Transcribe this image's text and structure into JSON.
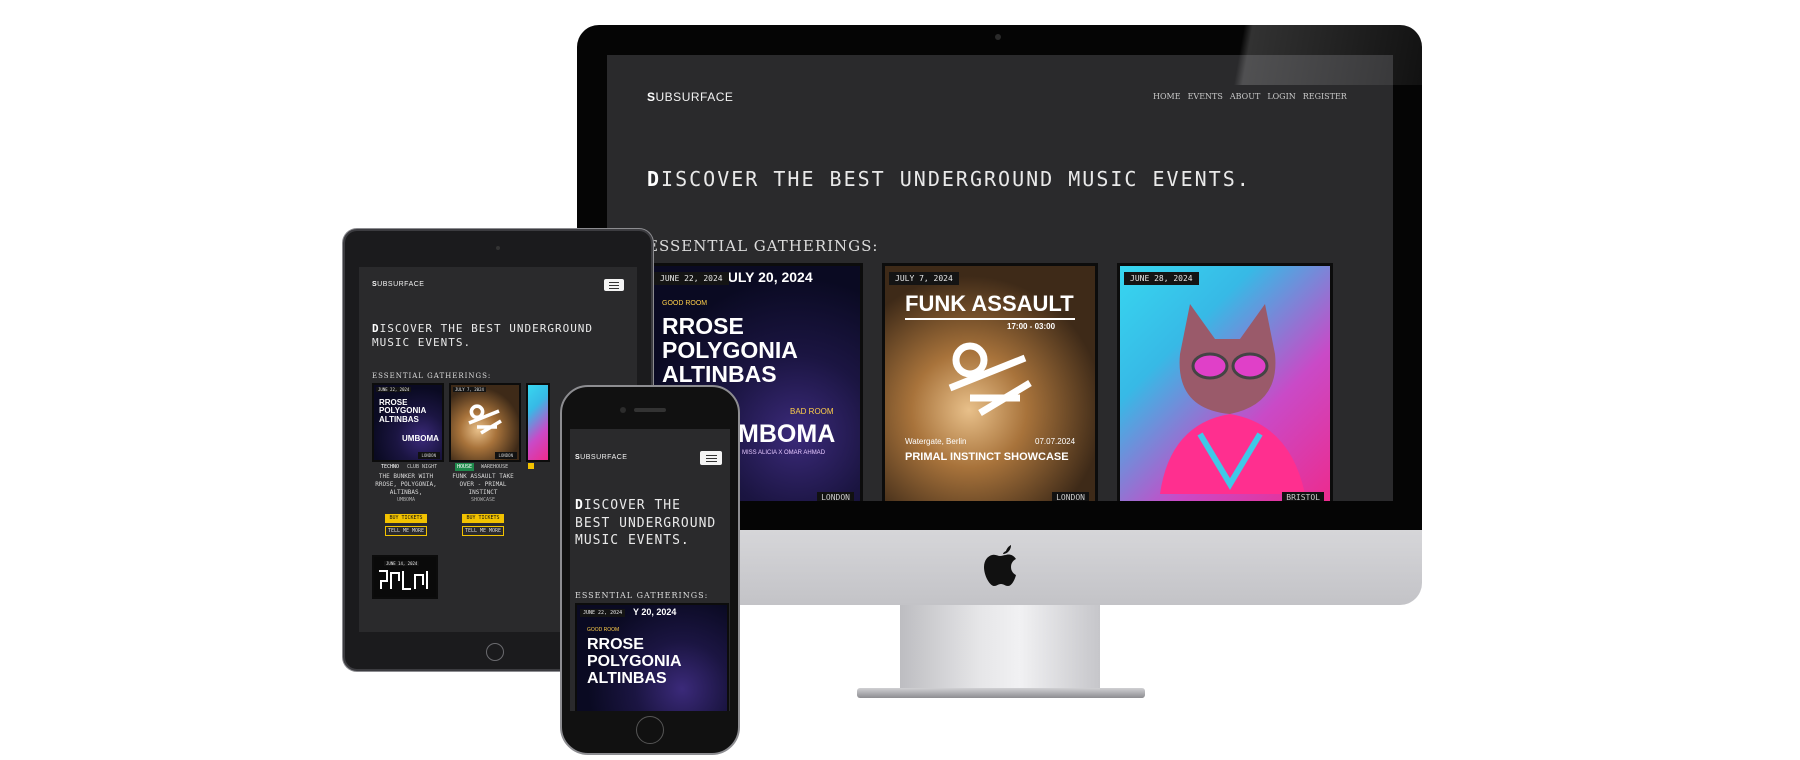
{
  "site": {
    "logo_first": "S",
    "logo_rest": "UBSURFACE",
    "logo_rest_short": "UBSURFACE",
    "nav": [
      "HOME",
      "EVENTS",
      "ABOUT",
      "LOGIN",
      "REGISTER"
    ],
    "hero_first": "D",
    "hero_rest": "ISCOVER THE BEST UNDERGROUND MUSIC EVENTS.",
    "section_title": "ESSENTIAL GATHERINGS:"
  },
  "desktop_cards": [
    {
      "date": "JUNE 22, 2024",
      "top": "JULY 20, 2024",
      "venue": "GOOD ROOM",
      "line1": "RROSE",
      "line2": "POLYGONIA",
      "line3": "ALTINBAS",
      "room": "BAD ROOM",
      "headliner": "UMBOMA",
      "support": "MISS ALICIA X OMAR AHMAD",
      "city": "LONDON"
    },
    {
      "date": "JULY 7, 2024",
      "title": "FUNK ASSAULT",
      "time": "17:00 - 03:00",
      "place": "Watergate, Berlin",
      "date2": "07.07.2024",
      "subtitle": "PRIMAL INSTINCT SHOWCASE",
      "city": "LONDON"
    },
    {
      "date": "JUNE 28, 2024",
      "city": "BRISTOL"
    }
  ],
  "tablet": {
    "cards": [
      {
        "date": "JUNE 22, 2024",
        "line1": "RROSE",
        "line2": "POLYGONIA",
        "line3": "ALTINBAS",
        "headliner": "UMBOMA",
        "city": "LONDON",
        "tag1": "TECHNO",
        "tag2": "CLUB NIGHT",
        "name": "THE BUNKER WITH RROSE, POLYGONIA, ALTINBAS,",
        "extra": "UMBOMA",
        "buy": "BUY TICKETS",
        "more": "TELL ME MORE"
      },
      {
        "date": "JULY 7, 2024",
        "city": "LONDON",
        "tag1": "HOUSE",
        "tag2": "WAREHOUSE",
        "name": "FUNK ASSAULT TAKE OVER - PRIMAL INSTINCT",
        "extra": "SHOWCASE",
        "buy": "BUY TICKETS",
        "more": "TELL ME MORE"
      }
    ],
    "bottom_date": "JUNE 14, 2024"
  },
  "phone": {
    "card": {
      "date": "JUNE 22, 2024",
      "top": "Y 20, 2024",
      "venue": "GOOD ROOM",
      "line1": "RROSE",
      "line2": "POLYGONIA",
      "line3": "ALTINBAS"
    }
  }
}
